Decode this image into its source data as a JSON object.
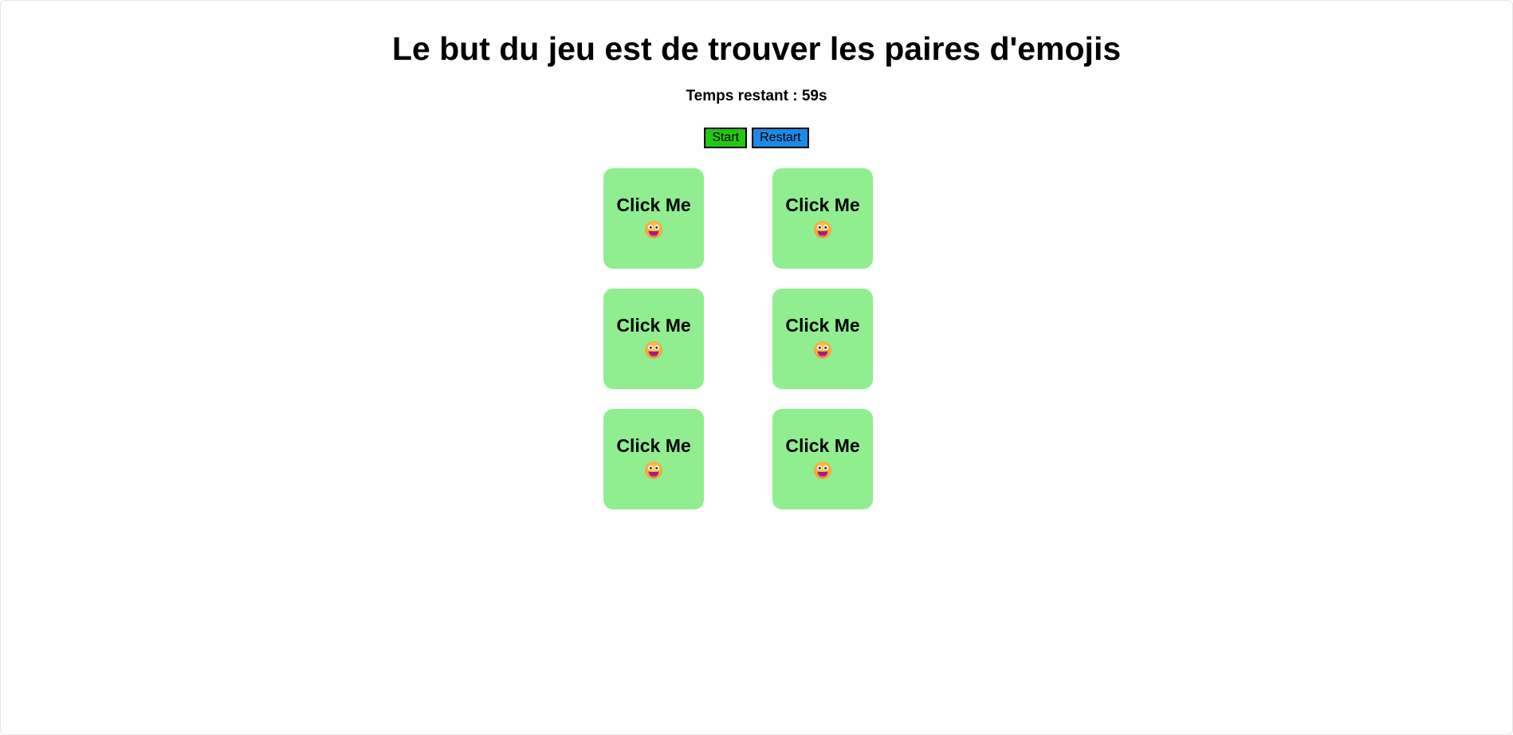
{
  "header": {
    "title": "Le but du jeu est de trouver les paires d'emojis"
  },
  "timer": {
    "text": "Temps restant : 59s"
  },
  "controls": {
    "start_label": "Start",
    "restart_label": "Restart"
  },
  "cards": [
    {
      "label": "Click Me",
      "icon": "grinning-face-icon"
    },
    {
      "label": "Click Me",
      "icon": "grinning-face-icon"
    },
    {
      "label": "Click Me",
      "icon": "grinning-face-icon"
    },
    {
      "label": "Click Me",
      "icon": "grinning-face-icon"
    },
    {
      "label": "Click Me",
      "icon": "grinning-face-icon"
    },
    {
      "label": "Click Me",
      "icon": "grinning-face-icon"
    }
  ],
  "colors": {
    "card_background": "#90ee90",
    "start_button": "#22c812",
    "restart_button": "#1a8ae6"
  }
}
